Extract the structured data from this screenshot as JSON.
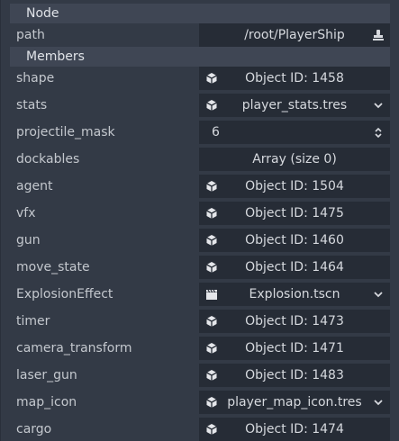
{
  "sections": {
    "node": "Node",
    "members": "Members"
  },
  "rows": [
    {
      "label": "path",
      "value": "/root/PlayerShip",
      "icon": "",
      "trail": "stamp-icon"
    },
    {
      "label": "shape",
      "value": "Object ID: 1458",
      "icon": "cube-icon",
      "trail": ""
    },
    {
      "label": "stats",
      "value": "player_stats.tres",
      "icon": "cube-icon",
      "trail": "chevron-down-icon"
    },
    {
      "label": "projectile_mask",
      "value": "6",
      "icon": "",
      "trail": "spinner-icon"
    },
    {
      "label": "dockables",
      "value": "Array (size 0)",
      "icon": "",
      "trail": ""
    },
    {
      "label": "agent",
      "value": "Object ID: 1504",
      "icon": "cube-icon",
      "trail": ""
    },
    {
      "label": "vfx",
      "value": "Object ID: 1475",
      "icon": "cube-icon",
      "trail": ""
    },
    {
      "label": "gun",
      "value": "Object ID: 1460",
      "icon": "cube-icon",
      "trail": ""
    },
    {
      "label": "move_state",
      "value": "Object ID: 1464",
      "icon": "cube-icon",
      "trail": ""
    },
    {
      "label": "ExplosionEffect",
      "value": "Explosion.tscn",
      "icon": "clapper-icon",
      "trail": "chevron-down-icon"
    },
    {
      "label": "timer",
      "value": "Object ID: 1473",
      "icon": "cube-icon",
      "trail": ""
    },
    {
      "label": "camera_transform",
      "value": "Object ID: 1471",
      "icon": "cube-icon",
      "trail": ""
    },
    {
      "label": "laser_gun",
      "value": "Object ID: 1483",
      "icon": "cube-icon",
      "trail": ""
    },
    {
      "label": "map_icon",
      "value": "player_map_icon.tres",
      "icon": "cube-icon",
      "trail": "chevron-down-icon"
    },
    {
      "label": "cargo",
      "value": "Object ID: 1474",
      "icon": "cube-icon",
      "trail": ""
    }
  ],
  "colors": {
    "background": "#333a46",
    "field": "#262c36",
    "header": "#3f4654"
  }
}
